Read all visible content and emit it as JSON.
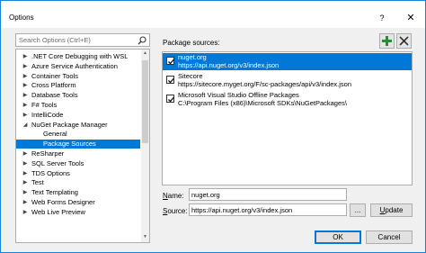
{
  "window": {
    "title": "Options",
    "help_label": "?",
    "close_label": "✕"
  },
  "search": {
    "placeholder": "Search Options (Ctrl+E)"
  },
  "tree": {
    "items": [
      {
        "label": ".NET Core Debugging with WSL",
        "expander": "▶",
        "level": 0
      },
      {
        "label": "Azure Service Authentication",
        "expander": "▶",
        "level": 0
      },
      {
        "label": "Container Tools",
        "expander": "▶",
        "level": 0
      },
      {
        "label": "Cross Platform",
        "expander": "▶",
        "level": 0
      },
      {
        "label": "Database Tools",
        "expander": "▶",
        "level": 0
      },
      {
        "label": "F# Tools",
        "expander": "▶",
        "level": 0
      },
      {
        "label": "IntelliCode",
        "expander": "▶",
        "level": 0
      },
      {
        "label": "NuGet Package Manager",
        "expander": "◢",
        "level": 0
      },
      {
        "label": "General",
        "expander": "",
        "level": 1
      },
      {
        "label": "Package Sources",
        "expander": "",
        "level": 1,
        "selected": true
      },
      {
        "label": "ReSharper",
        "expander": "▶",
        "level": 0
      },
      {
        "label": "SQL Server Tools",
        "expander": "▶",
        "level": 0
      },
      {
        "label": "TDS Options",
        "expander": "▶",
        "level": 0
      },
      {
        "label": "Test",
        "expander": "▶",
        "level": 0
      },
      {
        "label": "Text Templating",
        "expander": "▶",
        "level": 0
      },
      {
        "label": "Web Forms Designer",
        "expander": "▶",
        "level": 0
      },
      {
        "label": "Web Live Preview",
        "expander": "▶",
        "level": 0
      }
    ]
  },
  "package_sources": {
    "label": "Package sources:",
    "items": [
      {
        "name": "nuget.org",
        "url": "https://api.nuget.org/v3/index.json",
        "checked": true,
        "selected": true
      },
      {
        "name": "Sitecore",
        "url": "https://sitecore.myget.org/F/sc-packages/api/v3/index.json",
        "checked": true,
        "selected": false
      },
      {
        "name": "Microsoft Visual Studio Offline Packages",
        "url": "C:\\Program Files (x86)\\Microsoft SDKs\\NuGetPackages\\",
        "checked": true,
        "selected": false
      }
    ]
  },
  "form": {
    "name_label_key": "N",
    "name_label_rest": "ame:",
    "name_value": "nuget.org",
    "source_label_key": "S",
    "source_label_rest": "ource:",
    "source_value": "https://api.nuget.org/v3/index.json",
    "browse_label": "...",
    "update_label_key": "U",
    "update_label_rest": "pdate"
  },
  "footer": {
    "ok_label": "OK",
    "cancel_label": "Cancel"
  },
  "colors": {
    "accent": "#0078d7",
    "add_icon": "#2e8b2e",
    "remove_icon": "#333333"
  }
}
